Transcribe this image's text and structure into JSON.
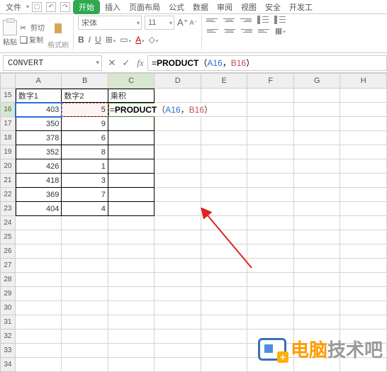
{
  "menu": {
    "file": "文件",
    "start": "开始",
    "insert": "插入",
    "layout": "页面布局",
    "formula": "公式",
    "data": "数据",
    "review": "审阅",
    "view": "视图",
    "security": "安全",
    "dev": "开发工"
  },
  "clipboard": {
    "paste": "粘贴",
    "cut": "剪切",
    "copy": "复制",
    "brush": "格式刷"
  },
  "font": {
    "name": "宋体",
    "size": "11"
  },
  "namebox": "CONVERT",
  "formula": {
    "eq": "=",
    "fn": "PRODUCT",
    "open": "（",
    "ref1": "A16",
    "comma": "，",
    "ref2": "B16",
    "close": "）"
  },
  "cols": [
    "A",
    "B",
    "C",
    "D",
    "E",
    "F",
    "G",
    "H"
  ],
  "row_start": 15,
  "row_count": 20,
  "headers": {
    "a": "数字1",
    "b": "数字2",
    "c": "乘积"
  },
  "values": {
    "a": [
      403,
      350,
      378,
      352,
      426,
      418,
      369,
      404
    ],
    "b": [
      5,
      9,
      6,
      8,
      1,
      3,
      7,
      4
    ]
  },
  "watermark": {
    "orange": "电脑",
    "gray": "技术吧"
  }
}
